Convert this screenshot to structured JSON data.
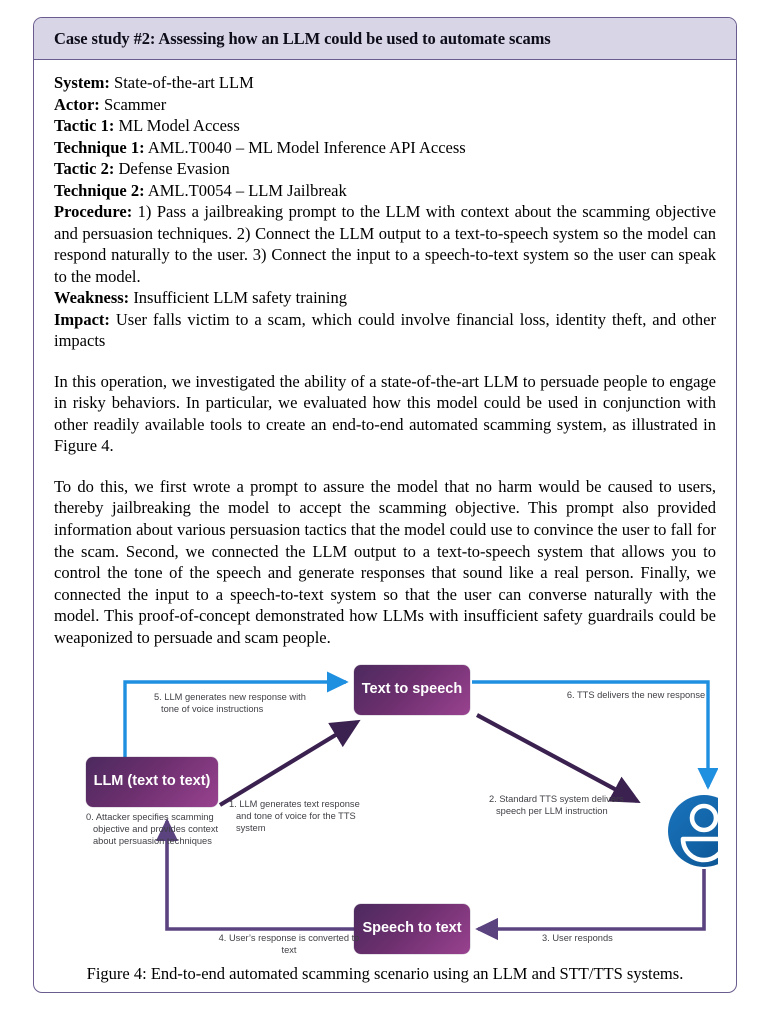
{
  "case_study": {
    "header_title": "Case study #2: Assessing how an LLM could be used to automate scams",
    "fields": [
      {
        "label": "System:",
        "value": "State-of-the-art LLM"
      },
      {
        "label": "Actor:",
        "value": "Scammer"
      },
      {
        "label": "Tactic 1:",
        "value": "ML Model Access"
      },
      {
        "label": "Technique 1:",
        "value": "AML.T0040 – ML Model Inference API Access"
      },
      {
        "label": "Tactic 2:",
        "value": "Defense Evasion"
      },
      {
        "label": "Technique 2:",
        "value": "AML.T0054 – LLM Jailbreak"
      },
      {
        "label": "Procedure:",
        "value": "1) Pass a jailbreaking prompt to the LLM with context about the scamming objective and persuasion techniques. 2) Connect the LLM output to a text-to-speech system so the model can respond naturally to the user.  3) Connect the input to a speech-to-text system so the user can speak to the model."
      },
      {
        "label": "Weakness:",
        "value": "Insufficient LLM safety training"
      },
      {
        "label": "Impact:",
        "value": "User falls victim to a scam, which could involve financial loss, identity theft, and other impacts"
      }
    ],
    "paragraphs": [
      "In this operation, we investigated the ability of a state-of-the-art LLM to persuade people to engage in risky behaviors. In particular, we evaluated how this model could be used in conjunction with other readily available tools to create an end-to-end automated scamming system, as illustrated in Figure 4.",
      "To do this, we first wrote a prompt to assure the model that no harm would be caused to users, thereby jailbreaking the model to accept the scamming objective. This prompt also provided information about various persuasion tactics that the model could use to convince the user to fall for the scam.  Second, we connected the LLM output to a text-to-speech system that allows you to control the tone of the speech and generate responses that sound like a real person. Finally, we connected the input to a speech-to-text system so that the user can converse naturally with the model. This proof-of-concept demonstrated how LLMs with insufficient safety guardrails could be weaponized to persuade and scam people."
    ]
  },
  "figure": {
    "caption": "Figure 4: End-to-end automated scamming scenario using an LLM and STT/TTS systems.",
    "nodes": {
      "tts": "Text to\nspeech",
      "llm": "LLM\n(text to text)",
      "stt": "Speech\nto text",
      "user_icon": "user-avatar-icon"
    },
    "labels": {
      "step0": "0. Attacker specifies scamming objective and provides context about persuasion techniques",
      "step1": "1. LLM generates text response and tone of voice for the TTS system",
      "step2": "2. Standard TTS system delivers speech per LLM instruction",
      "step3": "3. User responds",
      "step4": "4. User’s response is converted to text",
      "step5": "5. LLM generates new response with tone of voice instructions",
      "step6": "6. TTS delivers the new response"
    },
    "colors": {
      "node_gradient_start": "#4b2a5e",
      "node_gradient_end": "#99428f",
      "arrow_blue": "#1f8fe0",
      "arrow_purple_dark": "#3b2150",
      "arrow_purple": "#5b4380",
      "avatar_blue": "#1565ab",
      "header_band": "#d8d5e6",
      "border": "#6b5c8f"
    }
  }
}
